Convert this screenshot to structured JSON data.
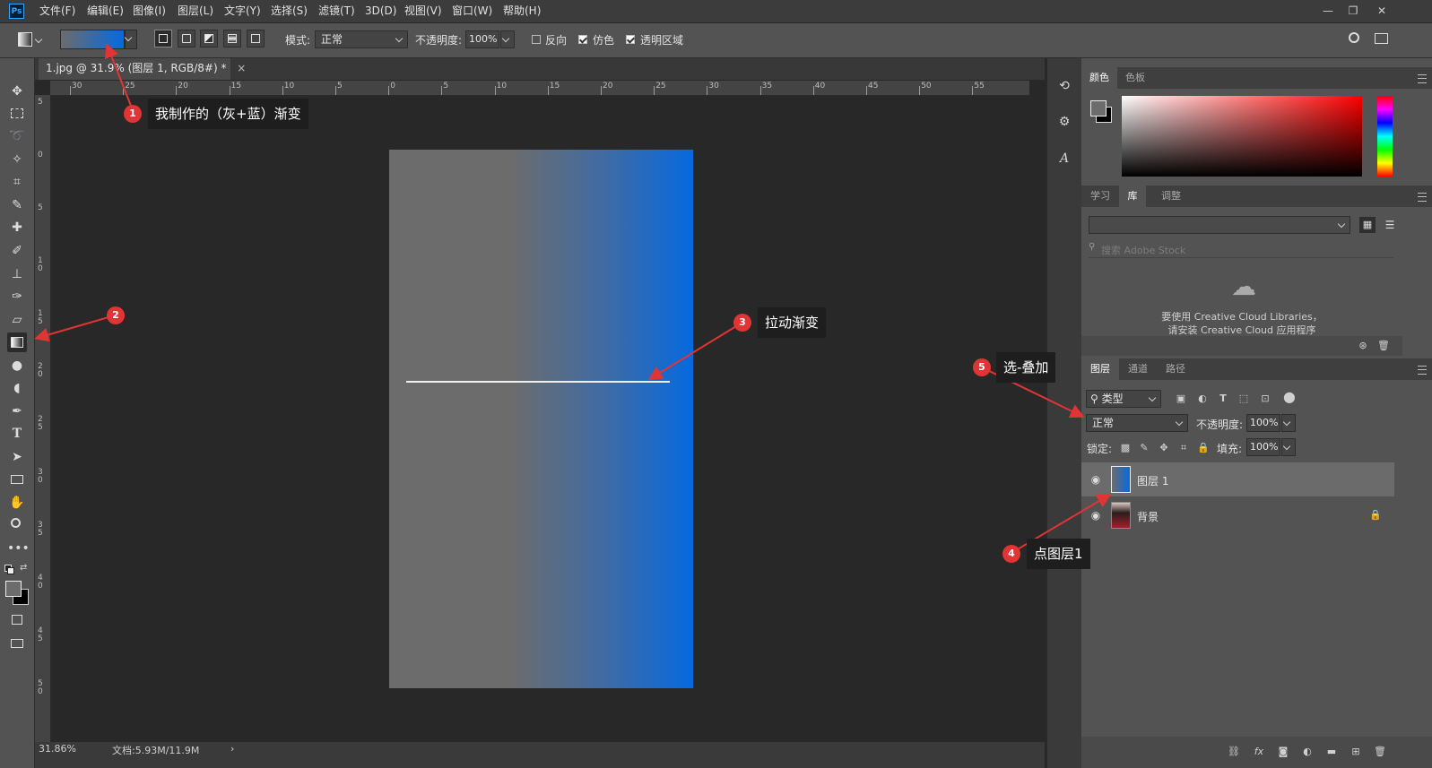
{
  "app": {
    "logo": "Ps"
  },
  "menu": [
    "文件(F)",
    "编辑(E)",
    "图像(I)",
    "图层(L)",
    "文字(Y)",
    "选择(S)",
    "滤镜(T)",
    "3D(D)",
    "视图(V)",
    "窗口(W)",
    "帮助(H)"
  ],
  "options": {
    "mode_label": "模式:",
    "mode_value": "正常",
    "opacity_label": "不透明度:",
    "opacity_value": "100%",
    "reverse_label": "反向",
    "dither_label": "仿色",
    "transparency_label": "透明区域"
  },
  "document": {
    "tab_title": "1.jpg @ 31.9% (图层 1, RGB/8#) *",
    "close": "×",
    "zoom": "31.86%",
    "doc_info": "文档:5.93M/11.9M",
    "status_arrow": "›"
  },
  "rulers": {
    "h_ticks": [
      "30",
      "25",
      "20",
      "15",
      "10",
      "5",
      "0",
      "5",
      "10",
      "15",
      "20",
      "25",
      "30",
      "35",
      "40",
      "45",
      "50",
      "55"
    ],
    "v_ticks": [
      "5",
      "0",
      "5",
      "1 0",
      "1 5",
      "2 0",
      "2 5",
      "3 0",
      "3 5",
      "4 0",
      "4 5",
      "5 0"
    ]
  },
  "panels": {
    "color_tabs": [
      "颜色",
      "色板"
    ],
    "library_tabs": [
      "学习",
      "库",
      "调整"
    ],
    "library_search_placeholder": "搜索 Adobe Stock",
    "library_message_line1": "要使用 Creative Cloud Libraries，",
    "library_message_line2": "请安装 Creative Cloud 应用程序",
    "layers_tabs": [
      "图层",
      "通道",
      "路径"
    ],
    "filter_kind": "类型",
    "blend_mode": "正常",
    "opacity_label": "不透明度:",
    "opacity_value": "100%",
    "lock_label": "锁定:",
    "fill_label": "填充:",
    "fill_value": "100%",
    "layers": [
      {
        "name": "图层 1"
      },
      {
        "name": "背景"
      }
    ]
  },
  "annotations": [
    {
      "number": "1",
      "text": "我制作的（灰+蓝）渐变"
    },
    {
      "number": "2",
      "text": ""
    },
    {
      "number": "3",
      "text": "拉动渐变"
    },
    {
      "number": "4",
      "text": "点图层1"
    },
    {
      "number": "5",
      "text": "选-叠加"
    }
  ],
  "colors": {
    "gradient_gray": "#6c6c6c",
    "gradient_blue": "#0669df",
    "annotation_red": "#e13434",
    "callout_bg": "#1e1e1e"
  }
}
